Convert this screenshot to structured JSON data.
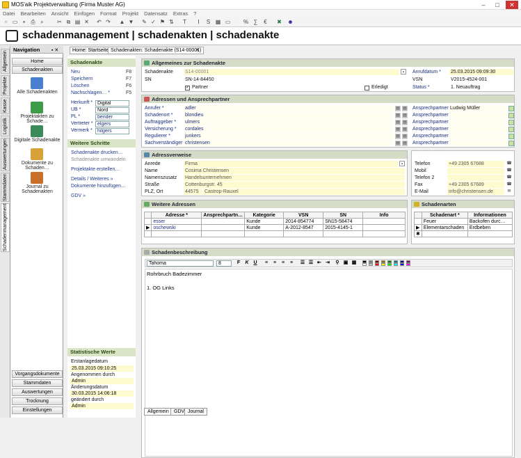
{
  "window": {
    "title": "MOS'aik Projektverwaltung (Firma Muster AG)"
  },
  "menu": [
    "Datei",
    "Bearbeiten",
    "Ansicht",
    "Einfügen",
    "Format",
    "Projekt",
    "Datensatz",
    "Extras",
    "?"
  ],
  "header": {
    "title": "schadenmanagement | schadenakten | schadenakte"
  },
  "sidetabs": [
    "Allgemein",
    "Projekte",
    "Kasse",
    "Logistik",
    "Auswertungen",
    "Stammdaten",
    "Schadenmanagement"
  ],
  "nav": {
    "title": "Navigation",
    "top_buttons": [
      "Home",
      "Schadenakten"
    ],
    "items": [
      "Alle Schadenakten",
      "Projektakten zu Schade…",
      "Digitale Schadenakte",
      "Dokumente zu Schaden…",
      "Journal zu Schadenakten"
    ],
    "bottom_buttons": [
      "Vorgangsdokumente",
      "Stammdaten",
      "Auswertungen",
      "Trocknung",
      "Einstellungen"
    ]
  },
  "doctabs": [
    "Home: Startseite",
    "Schadenakten: Schadenakte (S14-00001)"
  ],
  "left": {
    "schadenakte": {
      "title": "Schadenakte",
      "actions": [
        {
          "label": "Neu",
          "key": "F8"
        },
        {
          "label": "Speichern",
          "key": "F7"
        },
        {
          "label": "Löschen",
          "key": "F6"
        },
        {
          "label": "Nachschlagen…  *",
          "key": "F5"
        }
      ],
      "fields": [
        {
          "label": "Herkunft *",
          "value": "Digital"
        },
        {
          "label": "UB *",
          "value": "Nord"
        },
        {
          "label": "PL *",
          "value": "bender"
        },
        {
          "label": "Vertreter *",
          "value": "elgers"
        },
        {
          "label": "Vermerk *",
          "value": "hilgers"
        }
      ]
    },
    "weitere": {
      "title": "Weitere Schritte",
      "links": [
        "Schadenakte drucken…",
        "Schadenakte umwandeln",
        "Projektakte erstellen…",
        "Details / Weiteres »",
        "Dokumente hinzufügen…",
        "GDV »"
      ]
    },
    "stat": {
      "title": "Statistische Werte",
      "rows": [
        {
          "label": "Erstanlagedatum",
          "value": "25.03.2015 09:10:25"
        },
        {
          "label": "Angenommen durch",
          "value": "Admin"
        },
        {
          "label": "Änderungsdatum",
          "value": "30.03.2015 14:06:18"
        },
        {
          "label": "geändert durch",
          "value": "Admin"
        }
      ]
    }
  },
  "allgemeines": {
    "title": "Allgemeines zur Schadenakte",
    "schadenakte_label": "Schadenakte",
    "schadenakte": "S14-00001",
    "sn_label": "SN",
    "sn": "SN-14-84450",
    "partner": "Partner",
    "erledigt": "Erledigt",
    "anrufdatum_label": "Anrufdatum *",
    "anrufdatum": "25.03.2015 09:09:30",
    "vsn_label": "VSN",
    "vsn": "V2015-4524-001",
    "status_label": "Status *",
    "status": "1. Neuauftrag"
  },
  "adressen": {
    "title": "Adressen und Ansprechpartner",
    "rows": [
      {
        "label": "Anrufer *",
        "value": "adler"
      },
      {
        "label": "Schadenort *",
        "value": "blondieu"
      },
      {
        "label": "Auftraggeber *",
        "value": "ulmers"
      },
      {
        "label": "Versicherung *",
        "value": "cordales"
      },
      {
        "label": "Regulierer *",
        "value": "junkers"
      },
      {
        "label": "Sachverständiger *",
        "value": "christensen"
      }
    ],
    "ap_label": "Ansprechpartner *",
    "ap_values": [
      "Ludwig Müller",
      "",
      "",
      "",
      "",
      ""
    ]
  },
  "verweise": {
    "title": "Adressverweise",
    "rows": [
      {
        "label": "Anrede",
        "value": "Firma"
      },
      {
        "label": "Name",
        "value": "Cosima Christensen"
      },
      {
        "label": "Namenszusatz",
        "value": "Handelsunternehmen"
      },
      {
        "label": "Straße",
        "value": "Cottenburgstr. 45"
      }
    ],
    "plz_label": "PLZ, Ort",
    "plz": "44575",
    "ort": "Castrop-Rauxel",
    "contacts": [
      {
        "label": "Telefon",
        "value": "+49 2305 67688"
      },
      {
        "label": "Mobil",
        "value": ""
      },
      {
        "label": "Telefon 2",
        "value": ""
      },
      {
        "label": "Fax",
        "value": "+49 2305 67689"
      },
      {
        "label": "E-Mail",
        "value": "info@christensen.de"
      }
    ]
  },
  "weitere_adressen": {
    "title": "Weitere Adressen",
    "headers": [
      "Adresse *",
      "Ansprechpartn…",
      "Kategorie",
      "VSN",
      "SN",
      "Info"
    ],
    "rows": [
      [
        "esser",
        "",
        "Kunde",
        "2014-854774",
        "SN15-58474",
        ""
      ],
      [
        "oschewski",
        "",
        "Kunde",
        "A-2012-8547",
        "2015-4145-1",
        ""
      ]
    ]
  },
  "schadenarten": {
    "title": "Schadenarten",
    "headers": [
      "Schadenart *",
      "Informationen"
    ],
    "rows": [
      [
        "Feuer",
        "Backofen durc…"
      ],
      [
        "Elementarschaden",
        "Erdbeben"
      ]
    ]
  },
  "beschreibung": {
    "title": "Schadenbeschreibung",
    "font": "Tahoma",
    "size": "8",
    "lines": [
      "Rohrbruch Badezimmer",
      "",
      "1. OG Links"
    ]
  },
  "bottomtabs": [
    "Allgemein",
    "GDV",
    "Journal"
  ],
  "colors": {
    "section_header": "#d4dcc8",
    "group_header": "#d9e5c6",
    "highlight": "#fffbd0",
    "link": "#1f3c8f"
  }
}
